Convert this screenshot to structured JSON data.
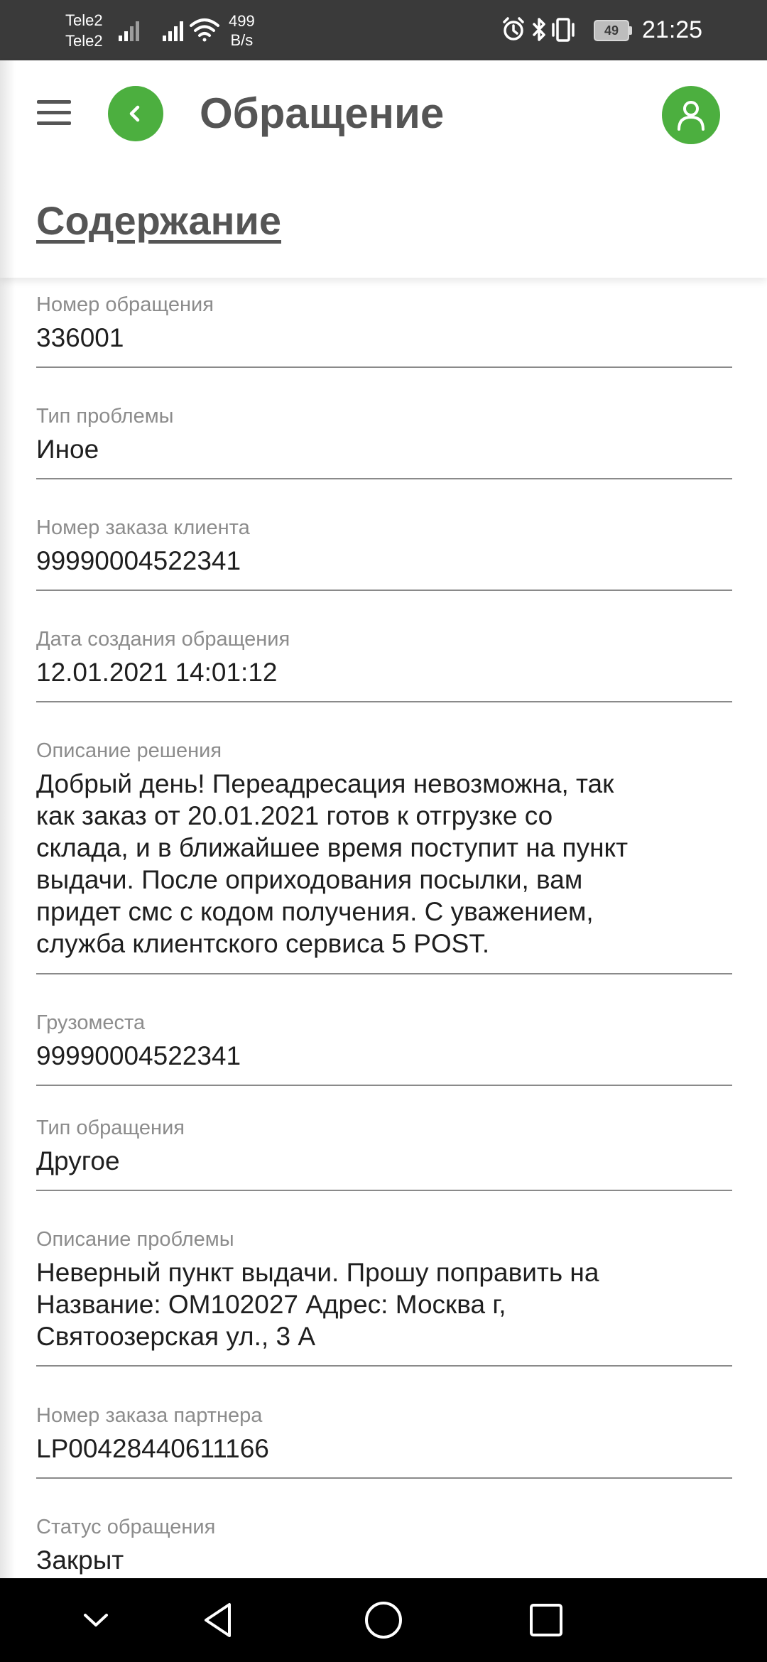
{
  "status_bar": {
    "carrier_1": "Tele2",
    "carrier_2": "Tele2",
    "net_speed_value": "499",
    "net_speed_unit": "B/s",
    "battery": "49",
    "time": "21:25"
  },
  "header": {
    "title": "Обращение",
    "section_title": "Содержание"
  },
  "fields": [
    {
      "label": "Номер обращения",
      "value": "336001"
    },
    {
      "label": "Тип проблемы",
      "value": "Иное"
    },
    {
      "label": "Номер заказа клиента",
      "value": "99990004522341"
    },
    {
      "label": "Дата создания обращения",
      "value": "12.01.2021 14:01:12"
    },
    {
      "label": "Описание решения",
      "value_lines": [
        "Добрый день! Переадресация невозможна, так",
        "как заказ от 20.01.2021 готов к отгрузке со",
        "склада, и в ближайшее время поступит на пункт",
        "выдачи. После оприходования посылки, вам",
        "придет смс с кодом получения. С уважением,",
        "служба клиентского сервиса 5 POST."
      ]
    },
    {
      "label": "Грузоместа",
      "value": "99990004522341"
    },
    {
      "label": "Тип обращения",
      "value": "Другое"
    },
    {
      "label": "Описание проблемы",
      "value_lines": [
        "Неверный пункт выдачи. Прошу поправить на",
        "Название: ОМ102027 Адрес: Москва г,",
        "Святоозерская ул., 3 А"
      ]
    },
    {
      "label": "Номер заказа партнера",
      "value": "LP00428440611166"
    },
    {
      "label": "Статус обращения",
      "value": "Закрыт"
    }
  ],
  "icons": {
    "menu": "hamburger-menu-icon",
    "back": "chevron-left-icon",
    "profile": "user-icon",
    "nav_collapse": "chevron-down-icon",
    "nav_back": "triangle-back-icon",
    "nav_home": "circle-home-icon",
    "nav_recents": "square-recents-icon"
  },
  "colors": {
    "accent_green": "#4caf3f",
    "status_bar_bg": "#3a3a3a",
    "title_text": "#555555",
    "label_text": "#8c8c8c",
    "divider": "#8a8a8a"
  }
}
